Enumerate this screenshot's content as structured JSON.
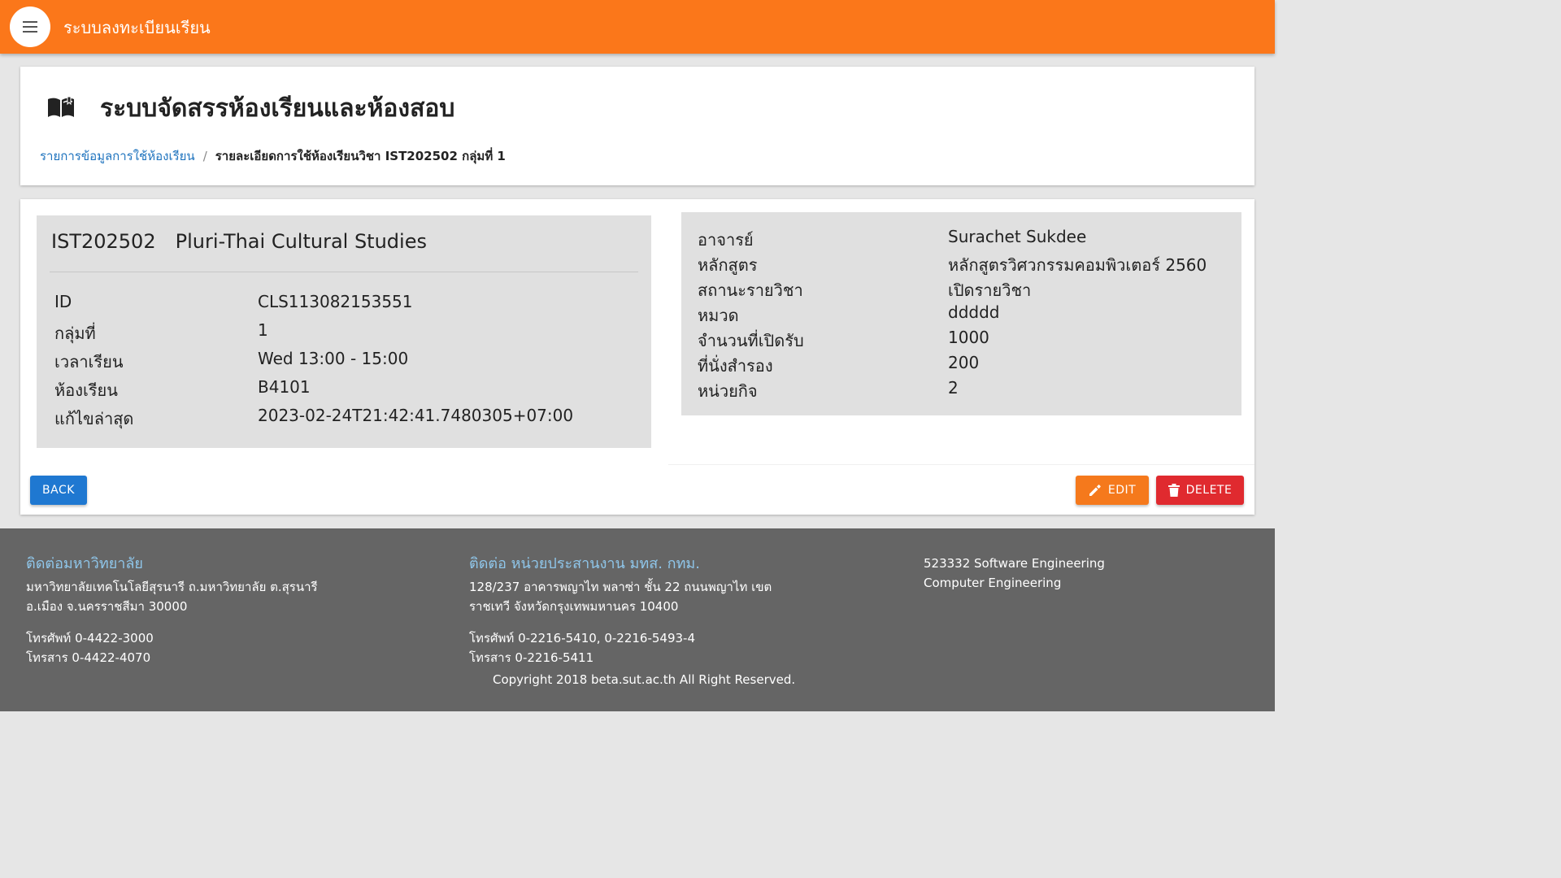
{
  "appbar": {
    "title": "ระบบลงทะเบียนเรียน",
    "menu_icon": "menu-icon"
  },
  "header": {
    "icon": "open-book-icon",
    "title": "ระบบจัดสรรห้องเรียนและห้องสอบ",
    "breadcrumb": {
      "link": "รายการข้อมูลการใช้ห้องเรียน",
      "separator": "/",
      "current": "รายละเอียดการใช้ห้องเรียนวิชา IST202502 กลุ่มที่ 1"
    }
  },
  "course": {
    "code": "IST202502",
    "name": "Pluri-Thai Cultural Studies"
  },
  "details": [
    {
      "label": "ID",
      "value": "CLS113082153551"
    },
    {
      "label": "กลุ่มที่",
      "value": "1"
    },
    {
      "label": "เวลาเรียน",
      "value": "Wed 13:00 - 15:00"
    },
    {
      "label": "ห้องเรียน",
      "value": "B4101"
    },
    {
      "label": "แก้ไขล่าสุด",
      "value": "2023-02-24T21:42:41.7480305+07:00"
    }
  ],
  "info": [
    {
      "label": "อาจารย์",
      "value": "Surachet Sukdee"
    },
    {
      "label": "หลักสูตร",
      "value": "หลักสูตรวิศวกรรมคอมพิวเตอร์ 2560"
    },
    {
      "label": "สถานะรายวิชา",
      "value": "เปิดรายวิชา"
    },
    {
      "label": "หมวด",
      "value": "ddddd"
    },
    {
      "label": "จำนวนที่เปิดรับ",
      "value": "1000"
    },
    {
      "label": "ที่นั่งสำรอง",
      "value": "200"
    },
    {
      "label": "หน่วยกิจ",
      "value": "2"
    }
  ],
  "buttons": {
    "back": "BACK",
    "edit": "EDIT",
    "delete": "DELETE"
  },
  "footer": {
    "col1": {
      "heading": "ติดต่อมหาวิทยาลัย",
      "line1": "มหาวิทยาลัยเทคโนโลยีสุรนารี ถ.มหาวิทยาลัย ต.สุรนารี",
      "line2": "อ.เมือง จ.นครราชสีมา 30000",
      "phone": "โทรศัพท์ 0-4422-3000",
      "fax": "โทรสาร 0-4422-4070"
    },
    "col2": {
      "heading": "ติดต่อ หน่วยประสานงาน มทส. กทม.",
      "line1": "128/237 อาคารพญาไท พลาซ่า ชั้น 22 ถนนพญาไท เขต",
      "line2": "ราชเทวี จังหวัดกรุงเทพมหานคร 10400",
      "phone": "โทรศัพท์ 0-2216-5410, 0-2216-5493-4",
      "fax": "โทรสาร 0-2216-5411"
    },
    "col3": {
      "line1": "523332 Software Engineering",
      "line2": "Computer Engineering"
    },
    "copyright": "Copyright 2018 beta.sut.ac.th All Right Reserved."
  },
  "colors": {
    "appbar": "#fb771a",
    "back": "#1f78d1",
    "edit": "#f5791c",
    "delete": "#e02a2f",
    "footer": "#656565",
    "footer_heading": "#8fc6ea",
    "link": "#1e73be"
  }
}
